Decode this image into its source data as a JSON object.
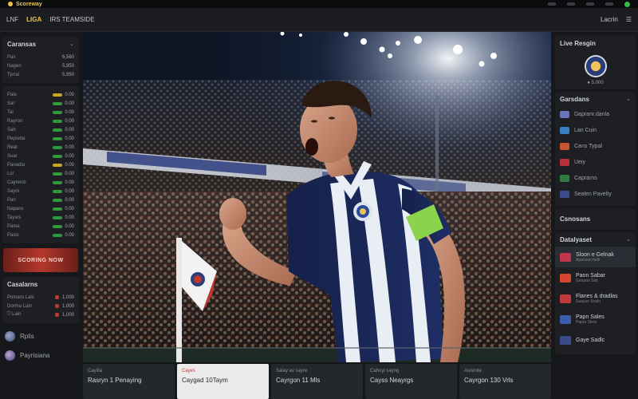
{
  "topbar": {
    "brand": "Scoreway"
  },
  "subnav": {
    "tabs": [
      "LNF",
      "LIGA",
      "IRS TEAMSIDE"
    ],
    "right_label": "Lacrin"
  },
  "left": {
    "panel1": {
      "title": "Caransas",
      "rows": [
        {
          "label": "Pav",
          "value": "6,560"
        },
        {
          "label": "Nagen",
          "value": "5,950"
        },
        {
          "label": "Tyrral",
          "value": "5,950"
        }
      ]
    },
    "panel2": {
      "rows": [
        {
          "label": "Palo",
          "value": "0.00",
          "pill": "#c9a521"
        },
        {
          "label": "Sar",
          "value": "0.00",
          "pill": "#2f9a3c"
        },
        {
          "label": "Tal",
          "value": "0.00",
          "pill": "#2f9a3c"
        },
        {
          "label": "Rayron",
          "value": "0.00",
          "pill": "#2f9a3c"
        },
        {
          "label": "Sah",
          "value": "0.00",
          "pill": "#2f9a3c"
        },
        {
          "label": "Pepretia",
          "value": "0.00",
          "pill": "#2f9a3c"
        },
        {
          "label": "Reat",
          "value": "0.00",
          "pill": "#2f9a3c"
        },
        {
          "label": "Suar",
          "value": "0.00",
          "pill": "#2f9a3c"
        },
        {
          "label": "Panadia",
          "value": "0.00",
          "pill": "#c9a521"
        },
        {
          "label": "Lsr",
          "value": "0.00",
          "pill": "#2f9a3c"
        },
        {
          "label": "Cayrenis",
          "value": "0.00",
          "pill": "#2f9a3c"
        },
        {
          "label": "Saym",
          "value": "0.00",
          "pill": "#2f9a3c"
        },
        {
          "label": "Pan",
          "value": "0.00",
          "pill": "#2f9a3c"
        },
        {
          "label": "Napans",
          "value": "0.00",
          "pill": "#2f9a3c"
        },
        {
          "label": "Taysrs",
          "value": "0.00",
          "pill": "#2f9a3c"
        },
        {
          "label": "Pame",
          "value": "0.00",
          "pill": "#2f9a3c"
        },
        {
          "label": "Pasis",
          "value": "0.00",
          "pill": "#2f9a3c"
        }
      ]
    },
    "promo": "SCORING NOW",
    "panel3": {
      "title": "Casalarns",
      "rows": [
        {
          "label": "Pomaro Lals",
          "value": "1,000"
        },
        {
          "label": "Dorma Lain",
          "value": "1,000"
        },
        {
          "label": "Lain",
          "value": "1,000"
        }
      ]
    },
    "links": [
      {
        "label": "Rplis"
      },
      {
        "label": "Payrisiana"
      }
    ]
  },
  "cards": [
    {
      "title": "Cayilla",
      "desc": "Rasryn 1 Penaying"
    },
    {
      "title": "Cayes",
      "desc": "Caygad 10Taym"
    },
    {
      "title": "Salay av sayre",
      "desc": "Cayrgon 11 Mls"
    },
    {
      "title": "Cahoyl sayng",
      "desc": "Cayss Neayrgs"
    },
    {
      "title": "Asrenite",
      "desc": "Cayrgon 130 Vrls"
    }
  ],
  "right": {
    "live": {
      "title": "Live Resgin",
      "score": "● 5,000"
    },
    "list1": {
      "title": "Garsdans",
      "items": [
        {
          "label": "Dapranr.danla",
          "color": "#6a73b8"
        },
        {
          "label": "Lan Cuin",
          "color": "#3a7fc1"
        },
        {
          "label": "Cans Typal",
          "color": "#c9552f"
        },
        {
          "label": "Ueiy",
          "color": "#b8323a"
        },
        {
          "label": "Caprarns",
          "color": "#2f7a3f"
        },
        {
          "label": "Sealen Pavelty",
          "color": "#3b4d8c"
        }
      ]
    },
    "list2": {
      "title": "Csnosans"
    },
    "list3": {
      "title": "Datalyaset",
      "items": [
        {
          "label": "Sloon e Gelnak",
          "sub": "Apansun fadil",
          "color": "#c2364b",
          "active": true
        },
        {
          "label": "Paon Sabar",
          "sub": "Ganpan Salr",
          "color": "#d4462d"
        },
        {
          "label": "Flanes & dradlas",
          "sub": "Saayas Sealn",
          "color": "#c23a3a"
        },
        {
          "label": "Papn Sales",
          "sub": "Papra Siren",
          "color": "#3b5ea8"
        },
        {
          "label": "Gaye Sadlc",
          "sub": "",
          "color": "#3a4a8c"
        }
      ]
    }
  },
  "colors": {
    "accent": "#f2c23b",
    "live": "#2fbf4a",
    "brand_navy": "#1d2c5a"
  }
}
